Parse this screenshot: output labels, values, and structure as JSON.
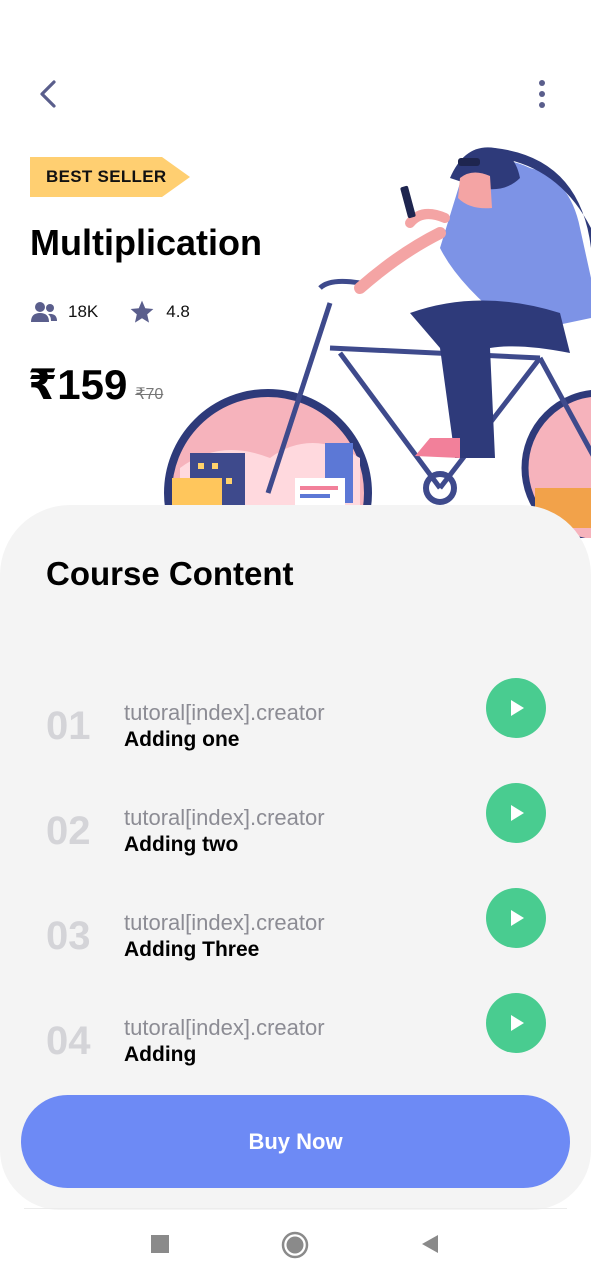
{
  "header": {
    "back_icon": "chevron-left-icon",
    "more_icon": "more-vertical-icon"
  },
  "course": {
    "badge": "BEST SELLER",
    "title": "Multiplication",
    "students": "18K",
    "rating": "4.8",
    "price": "₹159",
    "old_price": "₹70"
  },
  "content": {
    "title": "Course Content",
    "lessons": [
      {
        "number": "01",
        "creator": "tutoral[index].creator",
        "name": "Adding one"
      },
      {
        "number": "02",
        "creator": "tutoral[index].creator",
        "name": "Adding two"
      },
      {
        "number": "03",
        "creator": "tutoral[index].creator",
        "name": "Adding Three"
      },
      {
        "number": "04",
        "creator": "tutoral[index].creator",
        "name": "Adding"
      }
    ]
  },
  "cta": {
    "label": "Buy Now"
  },
  "colors": {
    "badge": "#FFCF71",
    "play": "#49CC90",
    "button": "#6D8AF5",
    "sheet": "#F4F4F4",
    "icon": "#5A5E8C"
  },
  "system_nav": {
    "recent_icon": "square-icon",
    "home_icon": "circle-icon",
    "back_icon": "triangle-back-icon"
  }
}
